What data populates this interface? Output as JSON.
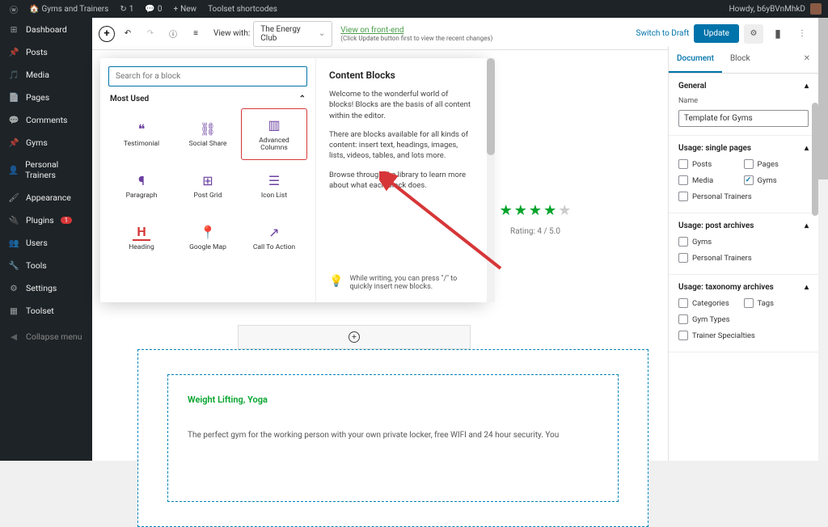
{
  "adminbar": {
    "site_name": "Gyms and Trainers",
    "updates": "1",
    "comments": "0",
    "new_label": "New",
    "shortcode_label": "Toolset shortcodes",
    "howdy": "Howdy, b6yBVnMhkD"
  },
  "sidebar": {
    "items": [
      {
        "icon": "dashboard",
        "label": "Dashboard"
      },
      {
        "icon": "pin",
        "label": "Posts"
      },
      {
        "icon": "media",
        "label": "Media"
      },
      {
        "icon": "page",
        "label": "Pages"
      },
      {
        "icon": "comment",
        "label": "Comments"
      },
      {
        "icon": "pin",
        "label": "Gyms"
      },
      {
        "icon": "person",
        "label": "Personal Trainers"
      },
      {
        "icon": "brush",
        "label": "Appearance"
      },
      {
        "icon": "plugin",
        "label": "Plugins",
        "badge": "1"
      },
      {
        "icon": "user",
        "label": "Users"
      },
      {
        "icon": "wrench",
        "label": "Tools"
      },
      {
        "icon": "settings",
        "label": "Settings"
      },
      {
        "icon": "toolset",
        "label": "Toolset"
      }
    ],
    "collapse": "Collapse menu"
  },
  "toolbar": {
    "view_with": "View with:",
    "select_value": "The Energy Club",
    "view_link": "View on front-end",
    "view_hint": "(Click Update button first to view the recent changes)",
    "switch_draft": "Switch to Draft",
    "update": "Update"
  },
  "inserter": {
    "search_placeholder": "Search for a block",
    "category": "Most Used",
    "blocks": [
      {
        "icon": "quote",
        "label": "Testimonial"
      },
      {
        "icon": "share",
        "label": "Social Share"
      },
      {
        "icon": "columns",
        "label": "Advanced\nColumns",
        "highlight": true
      },
      {
        "icon": "para",
        "label": "Paragraph"
      },
      {
        "icon": "grid",
        "label": "Post Grid"
      },
      {
        "icon": "list",
        "label": "Icon List"
      },
      {
        "icon": "heading",
        "label": "Heading"
      },
      {
        "icon": "map",
        "label": "Google Map"
      },
      {
        "icon": "cta",
        "label": "Call To Action"
      }
    ],
    "info_title": "Content Blocks",
    "info_p1": "Welcome to the wonderful world of blocks! Blocks are the basis of all content within the editor.",
    "info_p2": "There are blocks available for all kinds of content: insert text, headings, images, lists, videos, tables, and lots more.",
    "info_p3": "Browse through the library to learn more about what each block does.",
    "tip": "While writing, you can press \"/\" to quickly insert new blocks."
  },
  "content": {
    "rating_text": "Rating: 4 / 5.0",
    "rating_value": 4,
    "tax_links": "Weight Lifting, Yoga",
    "body": "The perfect gym for the working person with your own private locker, free WIFI and 24 hour security. You"
  },
  "settings": {
    "tabs": {
      "document": "Document",
      "block": "Block"
    },
    "general": {
      "title": "General",
      "name_label": "Name",
      "name_value": "Template for Gyms"
    },
    "usage_single": {
      "title": "Usage: single pages",
      "options": [
        {
          "label": "Posts",
          "checked": false
        },
        {
          "label": "Pages",
          "checked": false
        },
        {
          "label": "Media",
          "checked": false
        },
        {
          "label": "Gyms",
          "checked": true
        },
        {
          "label": "Personal Trainers",
          "checked": false,
          "full": true
        }
      ]
    },
    "usage_archives": {
      "title": "Usage: post archives",
      "options": [
        {
          "label": "Gyms",
          "checked": false,
          "full": true
        },
        {
          "label": "Personal Trainers",
          "checked": false,
          "full": true
        }
      ]
    },
    "usage_tax": {
      "title": "Usage: taxonomy archives",
      "options": [
        {
          "label": "Categories",
          "checked": false
        },
        {
          "label": "Tags",
          "checked": false
        },
        {
          "label": "Gym Types",
          "checked": false,
          "full": true
        },
        {
          "label": "Trainer Specialties",
          "checked": false,
          "full": true
        }
      ]
    }
  }
}
